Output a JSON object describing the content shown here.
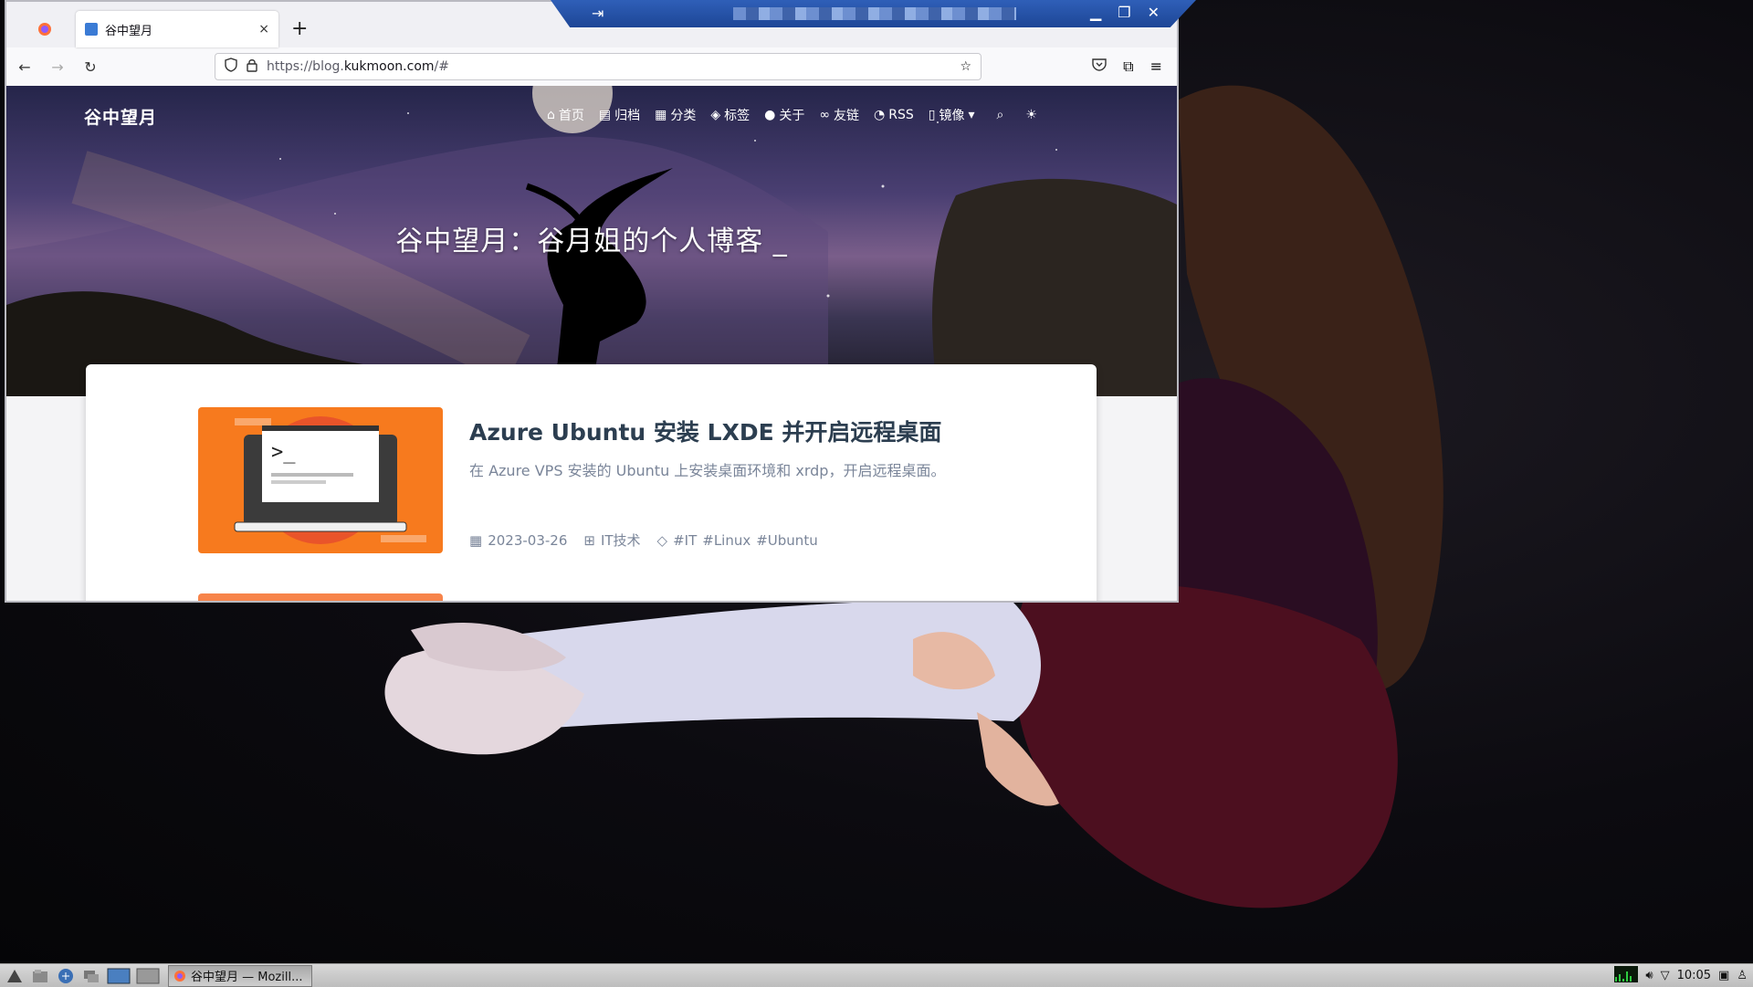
{
  "browser": {
    "tab_title": "谷中望月",
    "url_prefix": "https://blog.",
    "url_domain": "kukmoon.com",
    "url_suffix": "/#",
    "new_tab": "+",
    "tab_close": "×"
  },
  "site": {
    "title": "谷中望月",
    "hero_title": "谷中望月：谷月姐的个人博客 _",
    "menu": [
      {
        "icon": "home-icon",
        "label": "首页"
      },
      {
        "icon": "archive-icon",
        "label": "归档"
      },
      {
        "icon": "grid-icon",
        "label": "分类"
      },
      {
        "icon": "tag-icon",
        "label": "标签"
      },
      {
        "icon": "user-icon",
        "label": "关于"
      },
      {
        "icon": "link-icon",
        "label": "友链"
      },
      {
        "icon": "rss-icon",
        "label": "RSS"
      },
      {
        "icon": "mirror-icon",
        "label": "镜像"
      }
    ]
  },
  "post": {
    "title": "Azure Ubuntu 安装 LXDE 并开启远程桌面",
    "description": "在 Azure VPS 安装的 Ubuntu 上安装桌面环境和 xrdp，开启远程桌面。",
    "date": "2023-03-26",
    "category": "IT技术",
    "tags": [
      "#IT",
      "#Linux",
      "#Ubuntu"
    ]
  },
  "taskbar": {
    "task_label": "谷中望月 — Mozill...",
    "clock": "10:05"
  },
  "colors": {
    "accent": "#2f5fb8",
    "thumb": "#f77a1e",
    "title": "#2c3e50"
  }
}
